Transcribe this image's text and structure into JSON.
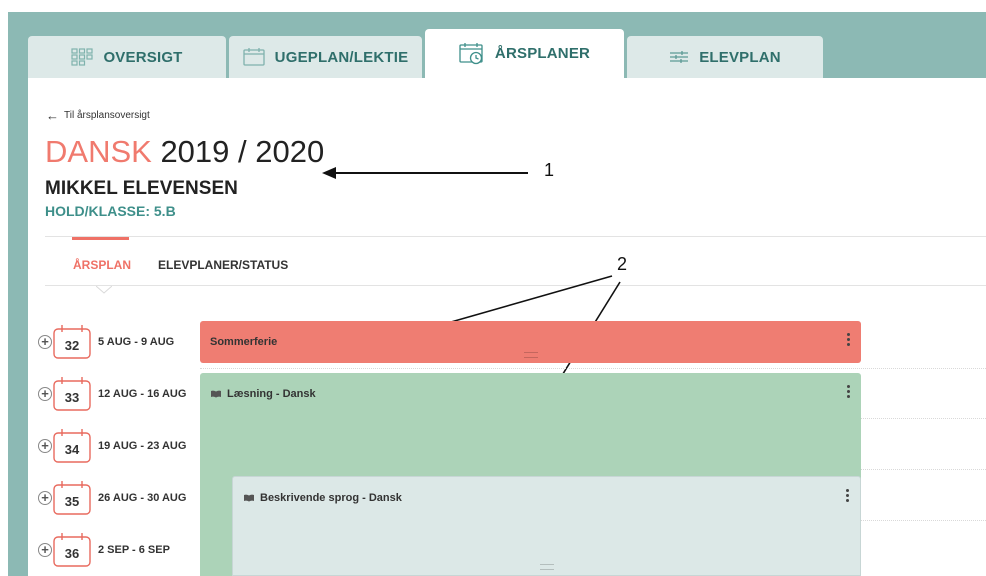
{
  "tabs": [
    {
      "label": "OVERSIGT",
      "icon": "grid-icon"
    },
    {
      "label": "UGEPLAN/LEKTIE",
      "icon": "calendar-icon"
    },
    {
      "label": "ÅRSPLANER",
      "icon": "calendar-clock-icon",
      "active": true
    },
    {
      "label": "ELEVPLAN",
      "icon": "sliders-icon"
    }
  ],
  "back_link": "Til årsplansoversigt",
  "header": {
    "subject": "DANSK",
    "year": "2019 / 2020",
    "student": "MIKKEL ELEVENSEN",
    "class": "HOLD/KLASSE: 5.B"
  },
  "subtabs": [
    {
      "label": "ÅRSPLAN",
      "active": true
    },
    {
      "label": "ELEVPLANER/STATUS",
      "active": false
    }
  ],
  "annotations": {
    "one": "1",
    "two": "2"
  },
  "weeks": [
    {
      "number": "32",
      "range": "5 AUG - 9 AUG"
    },
    {
      "number": "33",
      "range": "12 AUG - 16 AUG"
    },
    {
      "number": "34",
      "range": "19 AUG - 23 AUG"
    },
    {
      "number": "35",
      "range": "26 AUG - 30 AUG"
    },
    {
      "number": "36",
      "range": "2 SEP - 6 SEP"
    }
  ],
  "plans": [
    {
      "title": "Sommerferie",
      "color": "#ef7d72"
    },
    {
      "title": "Læsning - Dansk",
      "color": "#acd3b8",
      "icon": "book-icon"
    },
    {
      "title": "Beskrivende sprog - Dansk",
      "color": "#dce8e7",
      "icon": "book-icon"
    }
  ],
  "colors": {
    "accent": "#ef7166",
    "teal": "#3e8f8a",
    "background": "#8cb9b4"
  }
}
